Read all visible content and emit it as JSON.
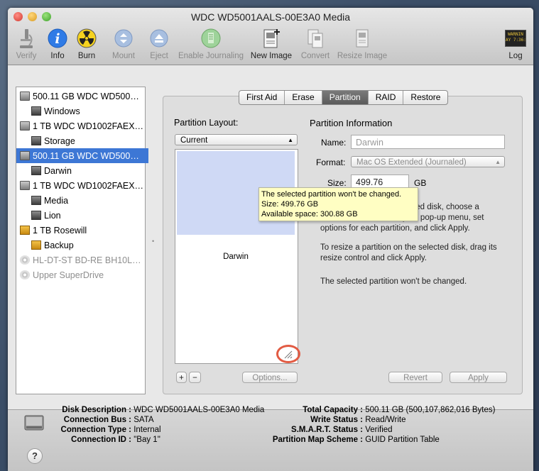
{
  "window": {
    "title": "WDC WD5001AALS-00E3A0 Media"
  },
  "toolbar": {
    "verify": "Verify",
    "info": "Info",
    "burn": "Burn",
    "mount": "Mount",
    "eject": "Eject",
    "enable_journaling": "Enable Journaling",
    "new_image": "New Image",
    "convert": "Convert",
    "resize_image": "Resize Image",
    "log": "Log",
    "log_icon_text": "WARNIN\nAY 7:36:"
  },
  "sidebar": {
    "items": [
      {
        "label": "500.11 GB WDC WD500…"
      },
      {
        "label": "Windows"
      },
      {
        "label": "1 TB WDC WD1002FAEX…"
      },
      {
        "label": "Storage"
      },
      {
        "label": "500.11 GB WDC WD500…"
      },
      {
        "label": "Darwin"
      },
      {
        "label": "1 TB WDC WD1002FAEX…"
      },
      {
        "label": "Media"
      },
      {
        "label": "Lion"
      },
      {
        "label": "1 TB Rosewill"
      },
      {
        "label": "Backup"
      },
      {
        "label": "HL-DT-ST BD-RE BH10L…"
      },
      {
        "label": "Upper SuperDrive"
      }
    ]
  },
  "tabs": [
    "First Aid",
    "Erase",
    "Partition",
    "RAID",
    "Restore"
  ],
  "partition": {
    "layout_heading": "Partition Layout:",
    "layout_value": "Current",
    "partition_name_in_map": "Darwin",
    "info_heading": "Partition Information",
    "name_label": "Name:",
    "name_value": "Darwin",
    "format_label": "Format:",
    "format_value": "Mac OS Extended (Journaled)",
    "size_label": "Size:",
    "size_value": "499.76",
    "size_unit": "GB",
    "help_text_1": "To erase and partition the selected disk, choose a layout from the Partition Layout pop-up menu, set options for each partition, and click Apply.",
    "help_text_1_visible_a": "elected disk, choose a",
    "help_text_1_visible_b": "yout pop-up menu, set",
    "help_text_1_visible_c": "options for each partition, and click Apply.",
    "help_text_2": "To resize a partition on the selected disk, drag its resize control and click Apply.",
    "help_text_3": "The selected partition won't be changed.",
    "add_button": "+",
    "remove_button": "−",
    "options_button": "Options...",
    "revert_button": "Revert",
    "apply_button": "Apply"
  },
  "tooltip": {
    "line1": "The selected partition won't be changed.",
    "line2": "Size: 499.76 GB",
    "line3": "Available space: 300.88 GB"
  },
  "details": {
    "disk_description_label": "Disk Description :",
    "disk_description": "WDC WD5001AALS-00E3A0 Media",
    "connection_bus_label": "Connection Bus :",
    "connection_bus": "SATA",
    "connection_type_label": "Connection Type :",
    "connection_type": "Internal",
    "connection_id_label": "Connection ID :",
    "connection_id": "\"Bay 1\"",
    "total_capacity_label": "Total Capacity :",
    "total_capacity": "500.11 GB (500,107,862,016 Bytes)",
    "write_status_label": "Write Status :",
    "write_status": "Read/Write",
    "smart_status_label": "S.M.A.R.T. Status :",
    "smart_status": "Verified",
    "partition_map_label": "Partition Map Scheme :",
    "partition_map": "GUID Partition Table"
  },
  "help_button": "?",
  "colors": {
    "selection": "#3d77d5",
    "highlight_ring": "#e25b43",
    "tooltip_bg": "#fffec3"
  }
}
